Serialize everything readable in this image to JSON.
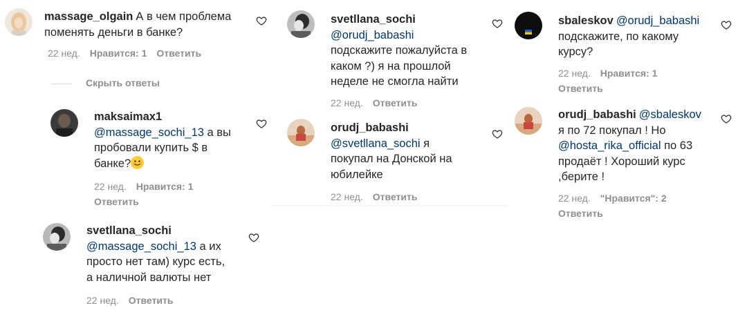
{
  "comments": {
    "c1": {
      "user": "massage_olgain",
      "text1": "А в чем проблема",
      "text2": "поменять деньги в банке?",
      "time": "22 нед.",
      "likes": "Нравится: 1",
      "reply": "Ответить"
    },
    "hide_replies": "Скрыть ответы",
    "c2": {
      "user": "maksaimax1",
      "mention": "@massage_sochi_13",
      "text1": " а вы",
      "text2": "пробовали купить $ в",
      "text3": "банке?",
      "time": "22 нед.",
      "likes": "Нравится: 1",
      "reply": "Ответить"
    },
    "c3": {
      "user": "svetllana_sochi",
      "mention": "@massage_sochi_13",
      "text1": " а их",
      "text2": "просто нет там) курс есть,",
      "text3": "а наличной валюты нет",
      "time": "22 нед.",
      "reply": "Ответить"
    },
    "c4": {
      "user": "svetllana_sochi",
      "mention": "@orudj_babashi",
      "text1": "подскажите пожалуйста в",
      "text2": "каком ?) я на прошлой",
      "text3": "неделе не смогла найти",
      "time": "22 нед.",
      "reply": "Ответить"
    },
    "c5": {
      "user": "orudj_babashi",
      "mention": "@svetllana_sochi",
      "text1": " я",
      "text2": "покупал на Донской на",
      "text3": "юбилейке",
      "time": "22 нед.",
      "reply": "Ответить"
    },
    "c6": {
      "user": "sbaleskov",
      "mention": "@orudj_babashi",
      "text1": "подскажите, по какому",
      "text2": "курсу?",
      "time": "22 нед.",
      "likes": "Нравится: 1",
      "reply": "Ответить"
    },
    "c7": {
      "user": "orudj_babashi",
      "mention": "@sbaleskov",
      "text1": "я по 72 покупал ! Но",
      "mention2": "@hosta_rika_official",
      "text2": " по 63",
      "text3": "продаёт ! Хороший курс",
      "text4": ",берите !",
      "time": "22 нед.",
      "likes": "\"Нравится\": 2",
      "reply": "Ответить"
    }
  },
  "icons": {
    "heart": "heart-outline-icon",
    "emoji": "smiling-face-icon"
  },
  "colors": {
    "text": "#262626",
    "secondary": "#8e8e8e",
    "mention": "#00376b"
  }
}
